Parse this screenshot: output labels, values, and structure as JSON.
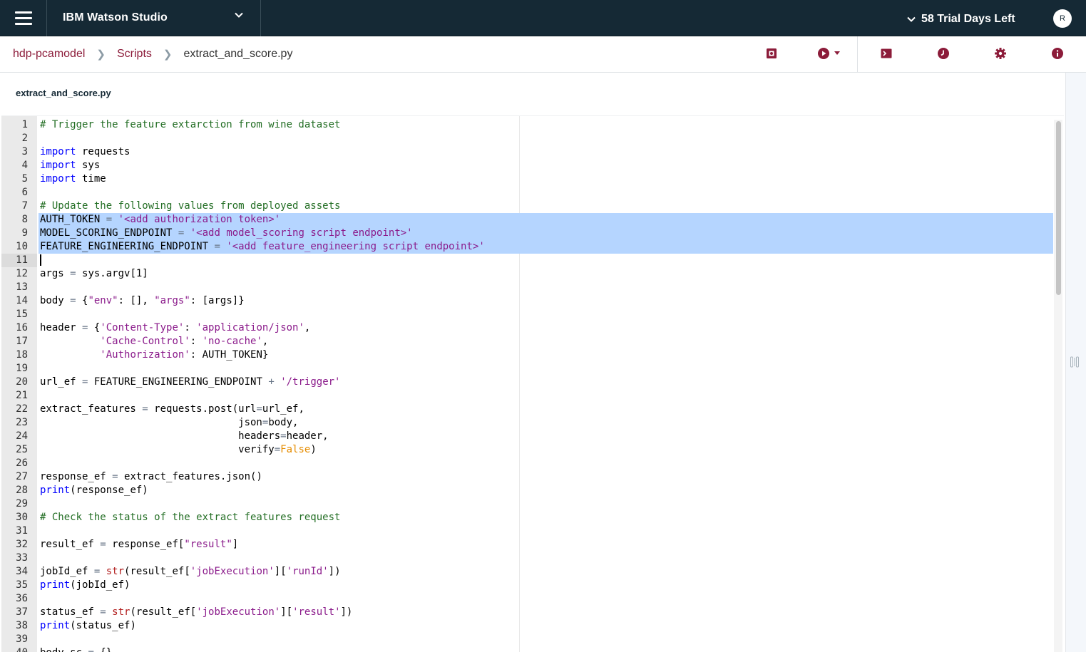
{
  "header": {
    "brand": "IBM Watson Studio",
    "trial": "58 Trial Days Left",
    "avatar_initial": "R",
    "background_color": "#152935"
  },
  "breadcrumb": {
    "project": "hdp-pcamodel",
    "section": "Scripts",
    "current": "extract_and_score.py",
    "link_color": "#8c1c3a"
  },
  "toolbar": {
    "icons": [
      "save-version-icon",
      "run-icon",
      "terminal-icon",
      "history-icon",
      "settings-icon",
      "info-icon"
    ],
    "accent_color": "#8c1c3a"
  },
  "file": {
    "title": "extract_and_score.py"
  },
  "editor": {
    "selected_lines": [
      8,
      9,
      10
    ],
    "active_line": 11,
    "lines": [
      {
        "n": "1",
        "text": "# Trigger the feature extarction from wine dataset"
      },
      {
        "n": "2",
        "text": ""
      },
      {
        "n": "3",
        "text": "import requests"
      },
      {
        "n": "4",
        "text": "import sys"
      },
      {
        "n": "5",
        "text": "import time"
      },
      {
        "n": "6",
        "text": ""
      },
      {
        "n": "7",
        "text": "# Update the following values from deployed assets"
      },
      {
        "n": "8",
        "text": "AUTH_TOKEN = '<add authorization token>'"
      },
      {
        "n": "9",
        "text": "MODEL_SCORING_ENDPOINT = '<add model_scoring script endpoint>'"
      },
      {
        "n": "10",
        "text": "FEATURE_ENGINEERING_ENDPOINT = '<add feature_engineering script endpoint>'"
      },
      {
        "n": "11",
        "text": ""
      },
      {
        "n": "12",
        "text": "args = sys.argv[1]"
      },
      {
        "n": "13",
        "text": ""
      },
      {
        "n": "14",
        "text": "body = {\"env\": [], \"args\": [args]}"
      },
      {
        "n": "15",
        "text": ""
      },
      {
        "n": "16",
        "text": "header = {'Content-Type': 'application/json',"
      },
      {
        "n": "17",
        "text": "          'Cache-Control': 'no-cache',"
      },
      {
        "n": "18",
        "text": "          'Authorization': AUTH_TOKEN}"
      },
      {
        "n": "19",
        "text": ""
      },
      {
        "n": "20",
        "text": "url_ef = FEATURE_ENGINEERING_ENDPOINT + '/trigger'"
      },
      {
        "n": "21",
        "text": ""
      },
      {
        "n": "22",
        "text": "extract_features = requests.post(url=url_ef,"
      },
      {
        "n": "23",
        "text": "                                 json=body,"
      },
      {
        "n": "24",
        "text": "                                 headers=header,"
      },
      {
        "n": "25",
        "text": "                                 verify=False)"
      },
      {
        "n": "26",
        "text": ""
      },
      {
        "n": "27",
        "text": "response_ef = extract_features.json()"
      },
      {
        "n": "28",
        "text": "print(response_ef)"
      },
      {
        "n": "29",
        "text": ""
      },
      {
        "n": "30",
        "text": "# Check the status of the extract features request"
      },
      {
        "n": "31",
        "text": ""
      },
      {
        "n": "32",
        "text": "result_ef = response_ef[\"result\"]"
      },
      {
        "n": "33",
        "text": ""
      },
      {
        "n": "34",
        "text": "jobId_ef = str(result_ef['jobExecution']['runId'])"
      },
      {
        "n": "35",
        "text": "print(jobId_ef)"
      },
      {
        "n": "36",
        "text": ""
      },
      {
        "n": "37",
        "text": "status_ef = str(result_ef['jobExecution']['result'])"
      },
      {
        "n": "38",
        "text": "print(status_ef)"
      },
      {
        "n": "39",
        "text": ""
      },
      {
        "n": "40",
        "text": "body_sc = {}"
      }
    ]
  }
}
